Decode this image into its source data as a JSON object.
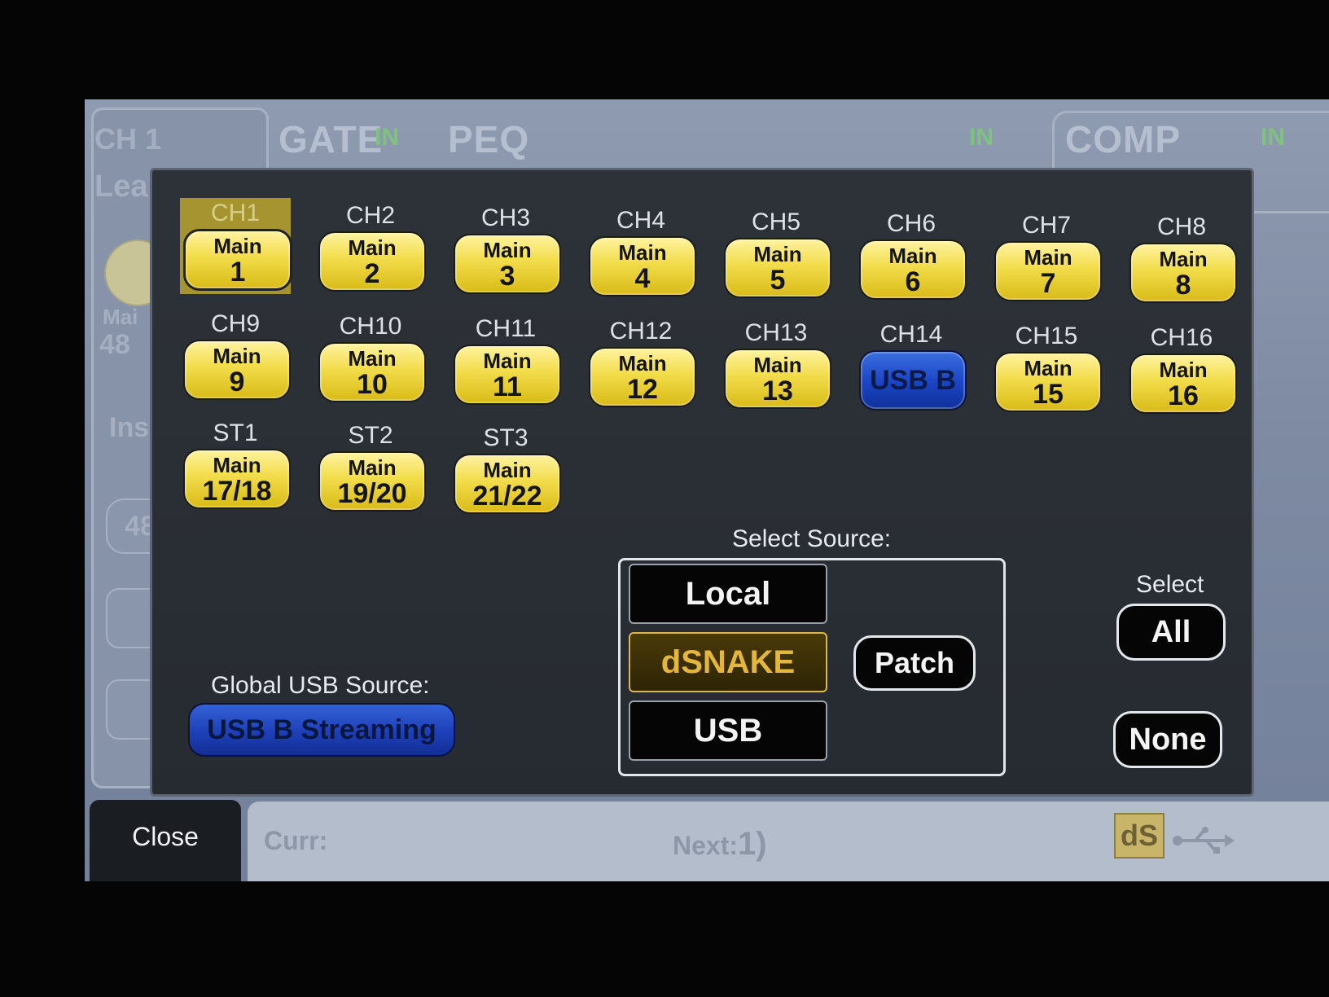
{
  "background": {
    "channel_name": "CH 1",
    "channel_sub": "Lea",
    "labels": [
      "Mai",
      "48",
      "Ins",
      "48"
    ],
    "tabs": [
      {
        "label": "GATE",
        "in": "IN"
      },
      {
        "label": "PEQ",
        "in": "IN"
      },
      {
        "label": "COMP",
        "in": "IN"
      }
    ]
  },
  "channels": [
    {
      "name": "CH1",
      "line1": "Main",
      "line2": "1",
      "style": "yellow",
      "selected": true
    },
    {
      "name": "CH2",
      "line1": "Main",
      "line2": "2",
      "style": "yellow"
    },
    {
      "name": "CH3",
      "line1": "Main",
      "line2": "3",
      "style": "yellow"
    },
    {
      "name": "CH4",
      "line1": "Main",
      "line2": "4",
      "style": "yellow"
    },
    {
      "name": "CH5",
      "line1": "Main",
      "line2": "5",
      "style": "yellow"
    },
    {
      "name": "CH6",
      "line1": "Main",
      "line2": "6",
      "style": "yellow"
    },
    {
      "name": "CH7",
      "line1": "Main",
      "line2": "7",
      "style": "yellow"
    },
    {
      "name": "CH8",
      "line1": "Main",
      "line2": "8",
      "style": "yellow"
    },
    {
      "name": "CH9",
      "line1": "Main",
      "line2": "9",
      "style": "yellow"
    },
    {
      "name": "CH10",
      "line1": "Main",
      "line2": "10",
      "style": "yellow"
    },
    {
      "name": "CH11",
      "line1": "Main",
      "line2": "11",
      "style": "yellow"
    },
    {
      "name": "CH12",
      "line1": "Main",
      "line2": "12",
      "style": "yellow"
    },
    {
      "name": "CH13",
      "line1": "Main",
      "line2": "13",
      "style": "yellow"
    },
    {
      "name": "CH14",
      "line1": "",
      "line2": "USB B",
      "style": "blue"
    },
    {
      "name": "CH15",
      "line1": "Main",
      "line2": "15",
      "style": "yellow"
    },
    {
      "name": "CH16",
      "line1": "Main",
      "line2": "16",
      "style": "yellow"
    },
    {
      "name": "ST1",
      "line1": "Main",
      "line2": "17/18",
      "style": "yellow"
    },
    {
      "name": "ST2",
      "line1": "Main",
      "line2": "19/20",
      "style": "yellow"
    },
    {
      "name": "ST3",
      "line1": "Main",
      "line2": "21/22",
      "style": "yellow"
    }
  ],
  "source": {
    "title": "Select Source:",
    "options": [
      "Local",
      "dSNAKE",
      "USB"
    ],
    "active": "dSNAKE",
    "patch_label": "Patch"
  },
  "select": {
    "title": "Select",
    "all_label": "All",
    "none_label": "None"
  },
  "global_usb": {
    "label": "Global USB Source:",
    "value": "USB B Streaming"
  },
  "footer": {
    "close_label": "Close",
    "curr_label": "Curr:",
    "next_label": "Next:",
    "next_value": "1)",
    "ds_badge": "dS",
    "usb_icon": "usb-icon"
  },
  "colors": {
    "button_yellow": "#f2dc4a",
    "button_blue": "#1d3fb8",
    "active_source": "#e3b63c",
    "popup_bg": "#2a2f35"
  }
}
